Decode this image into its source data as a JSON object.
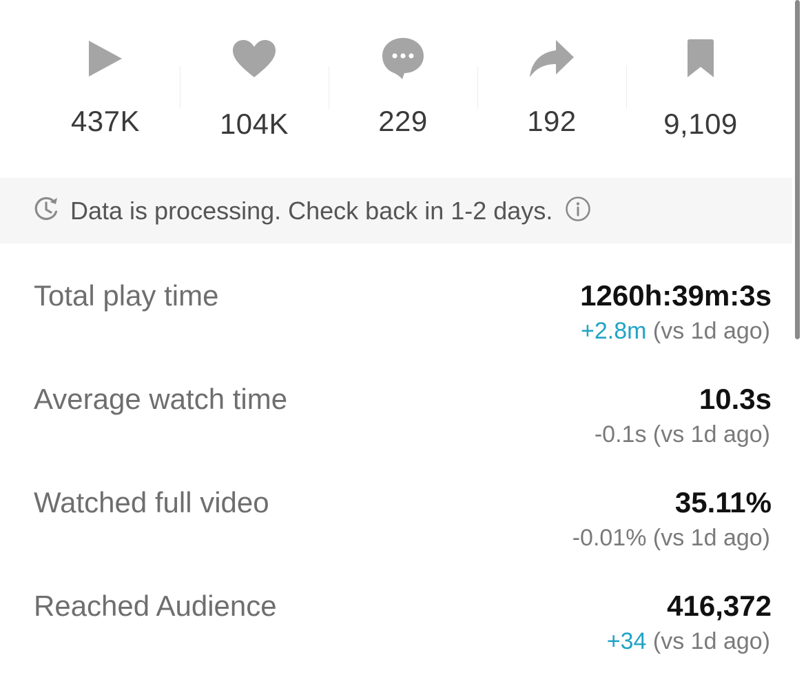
{
  "stats": [
    {
      "icon": "play-icon",
      "value": "437K"
    },
    {
      "icon": "heart-icon",
      "value": "104K"
    },
    {
      "icon": "comment-icon",
      "value": "229"
    },
    {
      "icon": "share-icon",
      "value": "192"
    },
    {
      "icon": "bookmark-icon",
      "value": "9,109"
    }
  ],
  "banner": {
    "icon": "clock-refresh-icon",
    "text": "Data is processing. Check back in 1-2 days.",
    "info_icon": "info-icon"
  },
  "metrics": [
    {
      "label": "Total play time",
      "value": "1260h:39m:3s",
      "delta": "+2.8m",
      "delta_direction": "up",
      "compare": "(vs 1d ago)"
    },
    {
      "label": "Average watch time",
      "value": "10.3s",
      "delta": "-0.1s",
      "delta_direction": "down",
      "compare": "(vs 1d ago)"
    },
    {
      "label": "Watched full video",
      "value": "35.11%",
      "delta": "-0.01%",
      "delta_direction": "down",
      "compare": "(vs 1d ago)"
    },
    {
      "label": "Reached Audience",
      "value": "416,372",
      "delta": "+34",
      "delta_direction": "up",
      "compare": "(vs 1d ago)"
    }
  ],
  "colors": {
    "icon_gray": "#a5a5a5",
    "positive": "#20a4c5",
    "banner_bg": "#f6f6f6"
  }
}
